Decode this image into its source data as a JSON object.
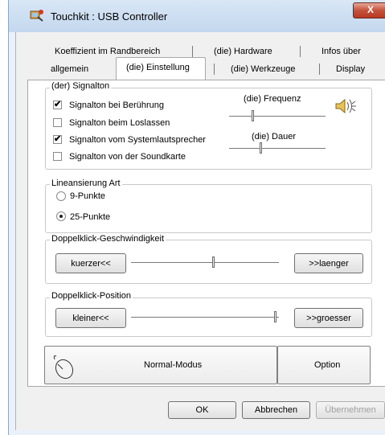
{
  "window": {
    "title": "Touchkit : USB Controller",
    "close_glyph": "X"
  },
  "tabs": {
    "row_back": [
      "Koeffizient im Randbereich",
      "(die) Hardware",
      "Infos über"
    ],
    "row_front": [
      "allgemein",
      "(die) Einstellung",
      "(die) Werkzeuge",
      "Display"
    ],
    "active": "(die) Einstellung"
  },
  "signalton": {
    "group_title": "(der) Signalton",
    "options": [
      {
        "label": "Signalton bei Berührung",
        "checked": true
      },
      {
        "label": "Signalton beim Loslassen",
        "checked": false
      },
      {
        "label": "Signalton vom Systemlautsprecher",
        "checked": true
      },
      {
        "label": "Signalton von der Soundkarte",
        "checked": false
      }
    ],
    "frequenz_label": "(die) Frequenz",
    "dauer_label": "(die) Dauer",
    "speaker_icon": "speaker-icon"
  },
  "linearisierung": {
    "group_title": "Lineansierung Art",
    "options": [
      {
        "label": "9-Punkte",
        "selected": false
      },
      {
        "label": "25-Punkte",
        "selected": true
      }
    ]
  },
  "doppelklick_geschwindigkeit": {
    "group_title": "Doppelklick-Geschwindigkeit",
    "left_button": "kuerzer<<",
    "right_button": ">>laenger"
  },
  "doppelklick_position": {
    "group_title": "Doppelklick-Position",
    "left_button": "kleiner<<",
    "right_button": ">>groesser"
  },
  "mode_buttons": {
    "normal": "Normal-Modus",
    "option": "Option",
    "mouse_icon": "mouse-icon"
  },
  "dialog_buttons": {
    "ok": "OK",
    "cancel": "Abbrechen",
    "apply": "Übernehmen"
  },
  "check_glyph": "✔"
}
